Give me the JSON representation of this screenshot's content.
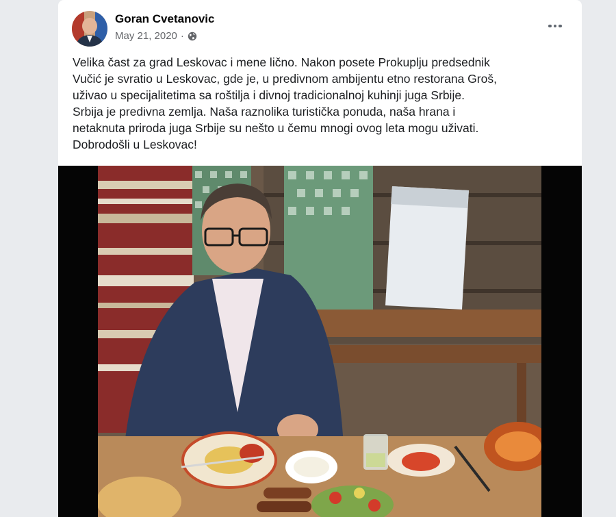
{
  "post": {
    "author": "Goran Cvetanovic",
    "date": "May 21, 2020",
    "separator": "·",
    "audience_icon": "globe-icon",
    "more_icon": "more-options-icon",
    "text": "Velika čast za grad Leskovac i mene lično. Nakon posete Prokuplju predsednik\nVučić je svratio u Leskovac, gde je, u predivnom ambijentu etno restorana Groš,\nuživao u specijalitetima sa roštilja i divnoj tradicionalnoj kuhinji juga Srbije.\nSrbija je predivna zemlja. Naša raznolika turistička ponuda, naša hrana i\nnetaknuta priroda juga Srbije su  nešto u čemu mnogi ovog leta mogu uživati.\nDobrodošli u Leskovac!"
  },
  "colors": {
    "page_bg": "#e9ebee",
    "card_bg": "#ffffff",
    "author": "#050505",
    "meta": "#65676b",
    "text": "#1c1e21"
  }
}
